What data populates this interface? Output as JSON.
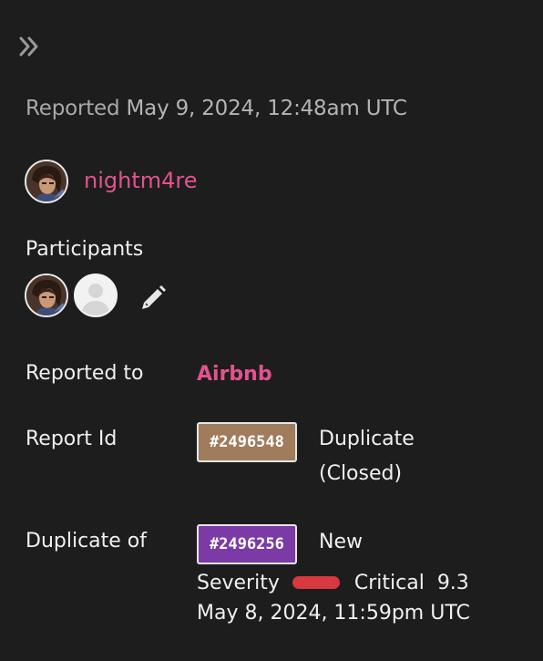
{
  "header": {
    "collapse_icon": "double-chevron-right-icon",
    "reported_prefix": "Reported",
    "reported_date": "May 9, 2024, 12:48am UTC"
  },
  "reporter": {
    "username": "nightm4re",
    "avatar_icon": "user-avatar"
  },
  "participants": {
    "label": "Participants",
    "items": [
      "user-avatar",
      "default-avatar"
    ],
    "edit_icon": "pencil-icon"
  },
  "details": {
    "reported_to_label": "Reported to",
    "reported_to_value": "Airbnb",
    "report_id_label": "Report Id",
    "report_id": "#2496548",
    "report_status": "Duplicate (Closed)",
    "duplicate_of_label": "Duplicate of",
    "duplicate_id": "#2496256",
    "duplicate_status": "New",
    "severity_label": "Severity",
    "severity_value": "Critical",
    "severity_score": "9.3",
    "duplicate_date": "May 8, 2024, 11:59pm UTC"
  },
  "colors": {
    "background": "#1d1d1d",
    "link": "#e2538f",
    "report_badge": "#a07c5c",
    "duplicate_badge": "#7b3aa6",
    "severity_critical": "#d8383f"
  }
}
